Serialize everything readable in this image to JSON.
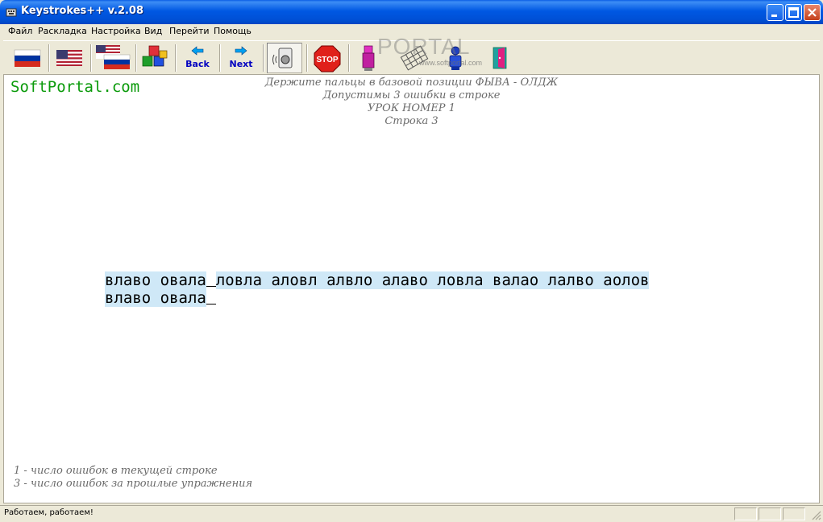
{
  "window": {
    "title": "Keystrokes++ v.2.08"
  },
  "menu": [
    "Файл",
    "Раскладка",
    "Настройка",
    "Вид",
    "Перейти",
    "Помощь"
  ],
  "toolbar": {
    "back_label": "Back",
    "next_label": "Next",
    "stop_label": "STOP"
  },
  "watermark": {
    "logo": "PORTAL",
    "url": "www.softportal.com"
  },
  "brand": "SoftPortal.com",
  "header": {
    "line1": "Держите пальцы в базовой позиции ФЫВА - ОЛДЖ",
    "line2": "Допустимы 3 ошибки в строке",
    "line3": "УРОК НОМЕР 1",
    "line4": "Строка 3"
  },
  "lesson": {
    "line1_typed": "влаво овала",
    "line1_rest": "ловла аловл алвло алаво ловла валао лалво аолов",
    "line2_typed": "влаво овала"
  },
  "legend": {
    "line1": "1  - число ошибок в текущей строке",
    "line2": "3  - число ошибок за прошлые упражнения"
  },
  "status": {
    "text": "Работаем, работаем!"
  },
  "colors": {
    "brand": "#0A9A0A",
    "highlight": "#CFE8F7",
    "titlebar": "#0058E3"
  }
}
